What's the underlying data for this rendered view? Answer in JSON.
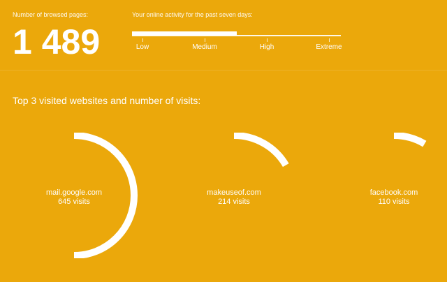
{
  "stats": {
    "label": "Number of browsed pages:",
    "value": "1 489"
  },
  "activity": {
    "label": "Your online activity for the past seven days:",
    "level": 0.5,
    "ticks": [
      "Low",
      "Medium",
      "High",
      "Extreme"
    ]
  },
  "top_sites": {
    "title": "Top 3 visited websites and number of visits:",
    "items": [
      {
        "name": "mail.google.com",
        "visits_text": "645 visits",
        "visits": 645
      },
      {
        "name": "makeuseof.com",
        "visits_text": "214 visits",
        "visits": 214
      },
      {
        "name": "facebook.com",
        "visits_text": "110 visits",
        "visits": 110
      }
    ]
  },
  "colors": {
    "background": "#EBA80B",
    "foreground": "#FFFFFF"
  }
}
